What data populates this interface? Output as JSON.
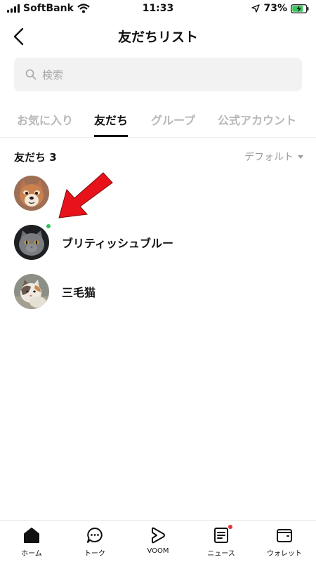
{
  "status_bar": {
    "carrier": "SoftBank",
    "time": "11:33",
    "battery": "73%"
  },
  "nav": {
    "title": "友だちリスト"
  },
  "search": {
    "placeholder": "検索"
  },
  "tabs": [
    {
      "label": "お気に入り",
      "active": false
    },
    {
      "label": "友だち",
      "active": true
    },
    {
      "label": "グループ",
      "active": false
    },
    {
      "label": "公式アカウント",
      "active": false
    }
  ],
  "section": {
    "title": "友だち 3",
    "sort_label": "デフォルト"
  },
  "friends": [
    {
      "name": "",
      "avatar": "shiba-dog-photo",
      "online": false
    },
    {
      "name": "ブリティッシュブルー",
      "avatar": "gray-cat-photo",
      "online": true
    },
    {
      "name": "三毛猫",
      "avatar": "calico-cat-photo",
      "online": false
    }
  ],
  "bottom_nav": [
    {
      "label": "ホーム",
      "icon": "home-icon",
      "badge": false
    },
    {
      "label": "トーク",
      "icon": "chat-icon",
      "badge": false
    },
    {
      "label": "VOOM",
      "icon": "voom-icon",
      "badge": false
    },
    {
      "label": "ニュース",
      "icon": "news-icon",
      "badge": true
    },
    {
      "label": "ウォレット",
      "icon": "wallet-icon",
      "badge": false
    }
  ],
  "colors": {
    "online": "#33c15a",
    "annotation_arrow": "#e8131a",
    "badge": "#e5333c"
  }
}
